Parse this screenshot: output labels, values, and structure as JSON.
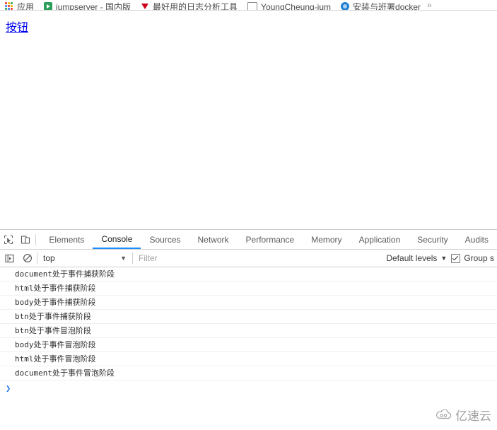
{
  "browser": {
    "bookmarks": [
      {
        "label": "应用",
        "icon": "apps-grid-icon",
        "icon_type": "apps"
      },
      {
        "label": "jumpserver - 国内版",
        "icon": "play-icon",
        "icon_type": "play"
      },
      {
        "label": "最好用的日志分析工具",
        "icon": "vercel-icon",
        "icon_type": "v"
      },
      {
        "label": "YoungCheung-jum",
        "icon": "document-icon",
        "icon_type": "doc"
      },
      {
        "label": "安装与班署docker",
        "icon": "circle-icon",
        "icon_type": "circle"
      }
    ]
  },
  "page": {
    "link_label": "按钮",
    "link_color": "#0000ee"
  },
  "devtools": {
    "tabs": [
      {
        "label": "Elements",
        "active": false
      },
      {
        "label": "Console",
        "active": true
      },
      {
        "label": "Sources",
        "active": false
      },
      {
        "label": "Network",
        "active": false
      },
      {
        "label": "Performance",
        "active": false
      },
      {
        "label": "Memory",
        "active": false
      },
      {
        "label": "Application",
        "active": false
      },
      {
        "label": "Security",
        "active": false
      },
      {
        "label": "Audits",
        "active": false
      }
    ],
    "active_tab_color": "#1a8cff",
    "console": {
      "context": "top",
      "filter_placeholder": "Filter",
      "filter_value": "",
      "levels_label": "Default levels",
      "group_similar_label": "Group s",
      "group_similar_checked": true,
      "messages": [
        "document处于事件捕获阶段",
        "html处于事件捕获阶段",
        "body处于事件捕获阶段",
        "btn处于事件捕获阶段",
        "btn处于事件冒泡阶段",
        "body处于事件冒泡阶段",
        "html处于事件冒泡阶段",
        "document处于事件冒泡阶段"
      ],
      "prompt_caret": "❯",
      "prompt_value": ""
    }
  },
  "watermark": {
    "text": "亿速云"
  }
}
